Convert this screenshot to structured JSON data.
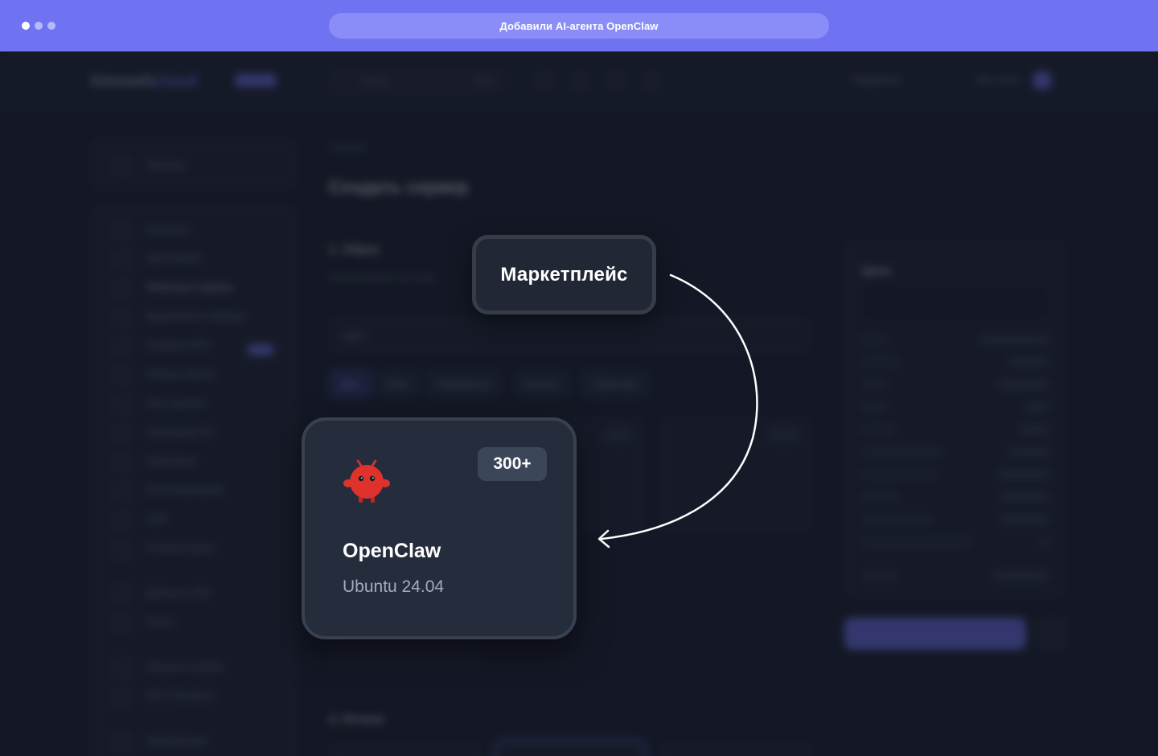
{
  "browser": {
    "address_text": "Добавили AI-агента OpenClaw"
  },
  "background": {
    "logo": {
      "brand": "timeweb",
      "suffix": "cloud"
    },
    "search_placeholder": "Поиск",
    "search_shortcut": "⌘ K",
    "support_label": "Поддержка",
    "user_label": "dev_team",
    "sidebar_top_item": "Проекты",
    "sidebar_items": [
      "AI-агенты",
      "App Platform",
      "Облачные серверы",
      "Выделенные серверы",
      "Серверы GPU",
      "Облака Ubuntu",
      "Базы данных",
      "Хранилище S3",
      "Kubernetes",
      "Балансировщики",
      "CDN",
      "Сетевые диски",
      "Домены и SSL",
      "Почта",
      "Бэкапы и снимки",
      "API и Terraform",
      "Уведомления"
    ],
    "breadcrumb": "Главная",
    "page_title": "Создать сервер",
    "section_image": "1. Образ",
    "section_image_sub": "Операционная система",
    "search_field_value": "open",
    "filter_chips": [
      "Все",
      "CMS",
      "Разработка",
      "Бизнес",
      "Пайплайн"
    ],
    "section_region": "2. Регион",
    "price": {
      "title": "Цена",
      "tabs": [
        "Час",
        "День",
        "Мес"
      ]
    }
  },
  "marketplace_label": "Маркетплейс",
  "featured_card": {
    "badge": "300+",
    "name": "OpenClaw",
    "os": "Ubuntu 24.04",
    "logo_icon": "red-crab-mascot"
  },
  "colors": {
    "accent": "#6f73f2",
    "card_bg": "#252d3d",
    "mascot": "#e0322d"
  }
}
